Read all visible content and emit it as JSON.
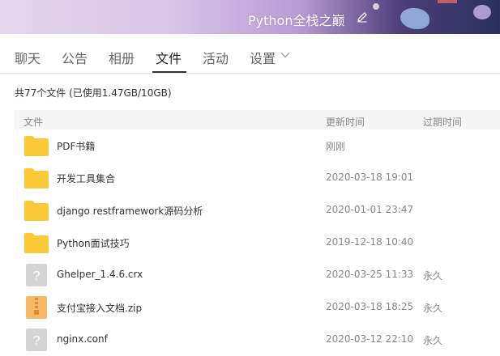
{
  "header": {
    "group_name": "Python全栈之巅",
    "banner_colors": [
      "#e3d6ec",
      "#b99ad4",
      "#2b2f5e"
    ]
  },
  "tabs": [
    {
      "label": "聊天"
    },
    {
      "label": "公告"
    },
    {
      "label": "相册"
    },
    {
      "label": "文件",
      "active": true
    },
    {
      "label": "活动"
    },
    {
      "label": "设置"
    }
  ],
  "summary": "共77个文件 (已使用1.47GB/10GB)",
  "columns": {
    "name": "文件",
    "updated": "更新时间",
    "expires": "过期时间"
  },
  "files": [
    {
      "name": "PDF书籍",
      "type": "folder-icon",
      "updated": "刚刚",
      "expires": ""
    },
    {
      "name": "开发工具集合",
      "type": "folder-icon",
      "updated": "2020-03-18 19:01",
      "expires": ""
    },
    {
      "name": "django restframework源码分析",
      "type": "folder-icon",
      "updated": "2020-01-01 23:47",
      "expires": ""
    },
    {
      "name": "Python面试技巧",
      "type": "folder-icon",
      "updated": "2019-12-18 10:40",
      "expires": ""
    },
    {
      "name": "Ghelper_1.4.6.crx",
      "type": "unknown-file-icon",
      "updated": "2020-03-25 11:33",
      "expires": "永久"
    },
    {
      "name": "支付宝接入文档.zip",
      "type": "zip-file-icon",
      "updated": "2020-03-18 18:25",
      "expires": "永久"
    },
    {
      "name": "nginx.conf",
      "type": "unknown-file-icon",
      "updated": "2020-03-12 22:10",
      "expires": "永久"
    }
  ],
  "colors": {
    "folder": "#fcc93a",
    "zip": "#f4b866",
    "unknown_file": "#d4d4d4",
    "header_bg": "#f5f5f6"
  }
}
